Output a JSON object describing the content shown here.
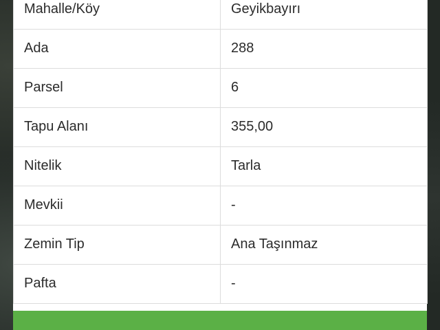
{
  "rows": [
    {
      "label": "Mahalle/Köy",
      "value": "Geyikbayırı"
    },
    {
      "label": "Ada",
      "value": "288"
    },
    {
      "label": "Parsel",
      "value": "6"
    },
    {
      "label": "Tapu Alanı",
      "value": "355,00"
    },
    {
      "label": "Nitelik",
      "value": "Tarla"
    },
    {
      "label": "Mevkii",
      "value": "-"
    },
    {
      "label": "Zemin Tip",
      "value": "Ana Taşınmaz"
    },
    {
      "label": "Pafta",
      "value": "-"
    }
  ],
  "colors": {
    "action_bar": "#5bb046",
    "border": "#dcdcdc",
    "text": "#2b2b2b",
    "background_map": "#232925"
  }
}
